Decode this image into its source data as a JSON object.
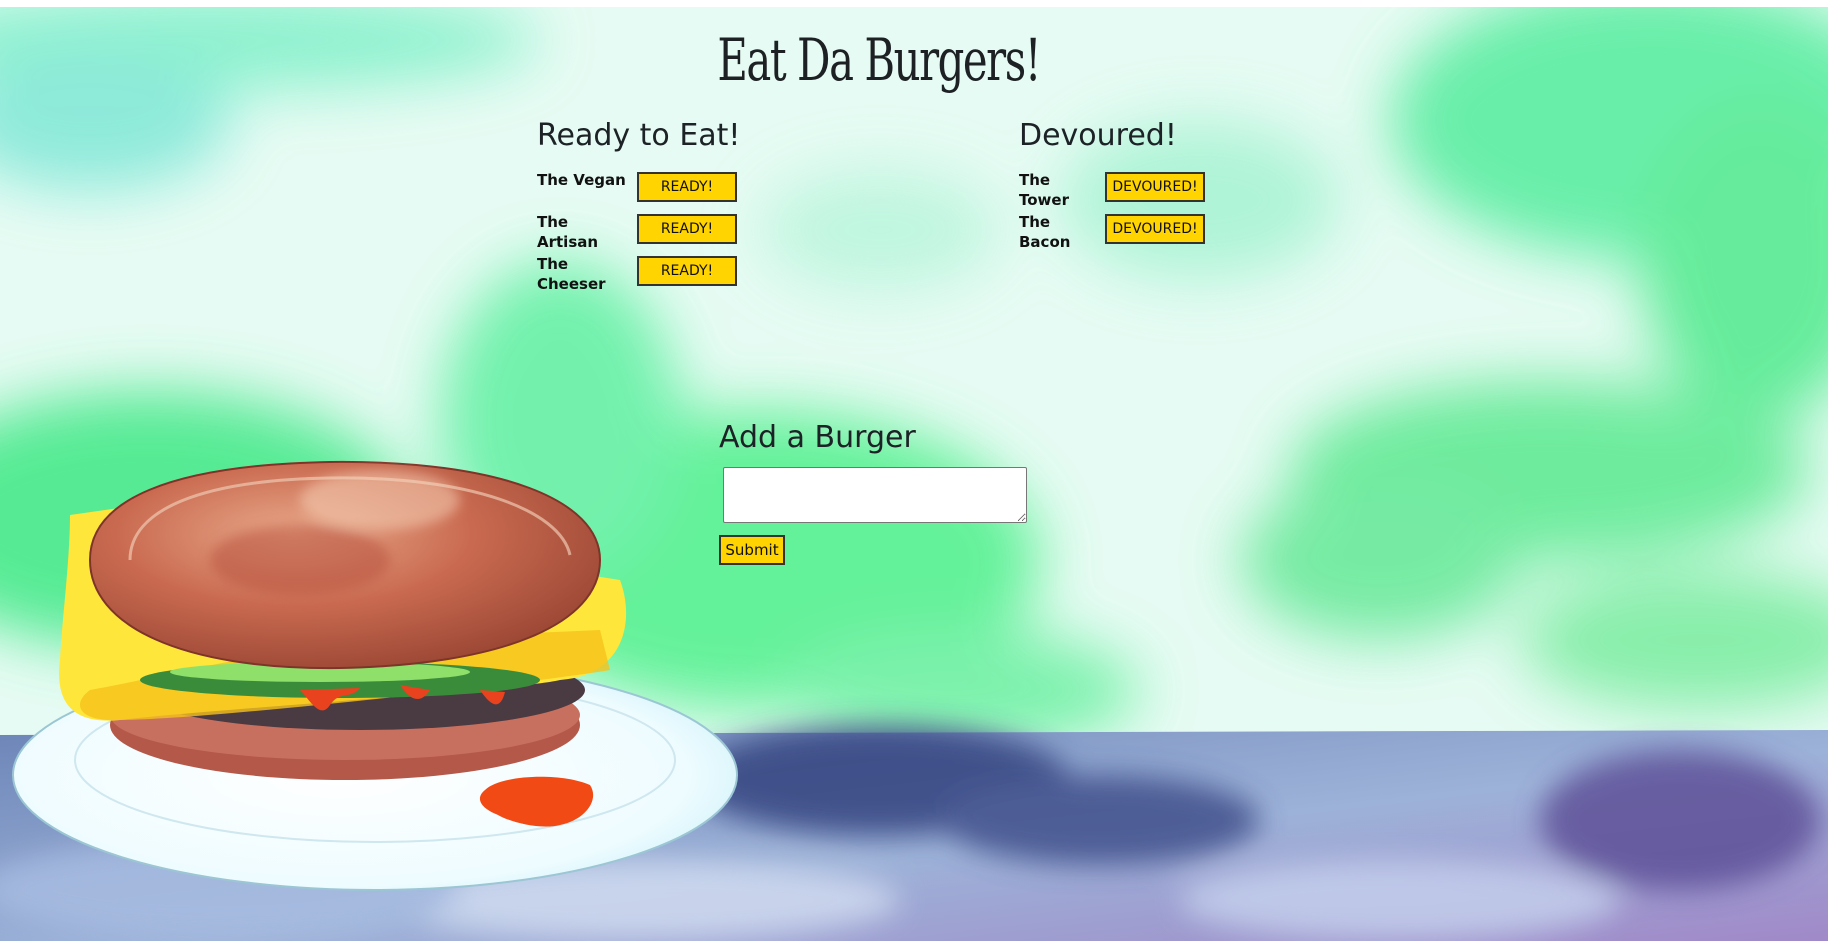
{
  "header": {
    "title": "Eat Da Burgers!"
  },
  "ready": {
    "heading": "Ready to Eat!",
    "items": [
      {
        "name": "The Vegan",
        "button": "READY!"
      },
      {
        "name": "The Artisan",
        "button": "READY!"
      },
      {
        "name": "The Cheeser",
        "button": "READY!"
      }
    ]
  },
  "devoured": {
    "heading": "Devoured!",
    "items": [
      {
        "name": "The Tower",
        "button": "DEVOURED!"
      },
      {
        "name": "The Bacon",
        "button": "DEVOURED!"
      }
    ]
  },
  "add_form": {
    "heading": "Add a Burger",
    "input_value": "",
    "submit_label": "Submit"
  },
  "colors": {
    "button_yellow": "#ffd400",
    "sky_green": "#3ce87a",
    "table_blue": "#4e5b96",
    "bun": "#c45a44",
    "cheese": "#ffe43a"
  }
}
